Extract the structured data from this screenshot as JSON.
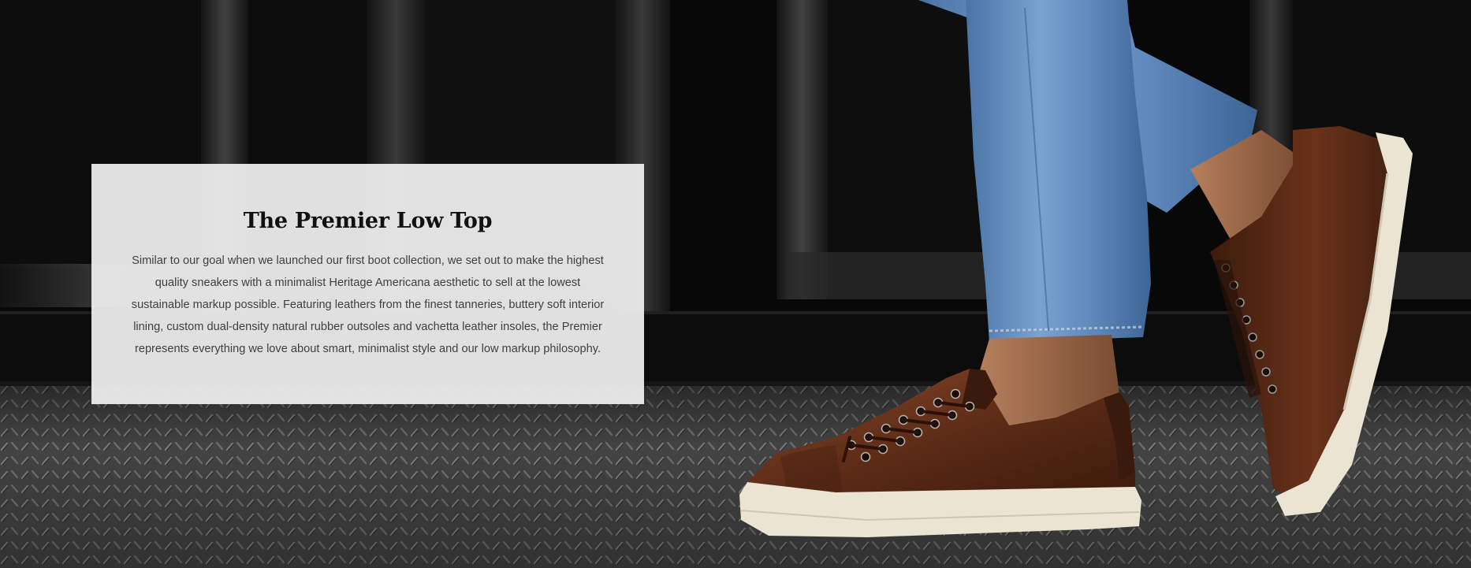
{
  "hero": {
    "title": "The Premier Low Top",
    "description": "Similar to our goal when we launched our first boot collection, we set out to make the highest quality sneakers with a minimalist Heritage Americana aesthetic to sell at the lowest sustainable markup possible. Featuring leathers from the finest tanneries, buttery soft interior lining, custom dual-density natural rubber outsoles and vachetta leather insoles, the Premier represents everything we love about smart, minimalist style and our low markup philosophy.",
    "colors": {
      "card_background": "#eeeeee",
      "title": "#111111",
      "body_text": "#3f3f3f",
      "leather_brown": "#5a2a16",
      "sole_cream": "#ece4d2",
      "denim_blue": "#6b95c4"
    }
  }
}
